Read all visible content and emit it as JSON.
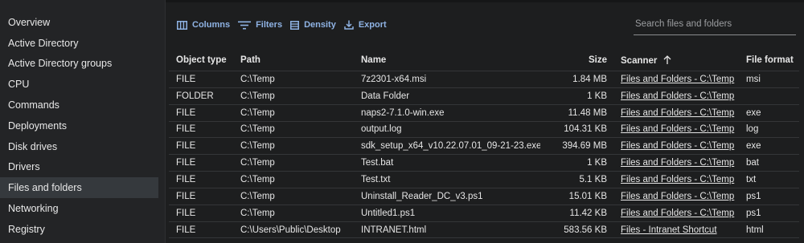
{
  "sidebar": {
    "items": [
      {
        "label": "Overview"
      },
      {
        "label": "Active Directory"
      },
      {
        "label": "Active Directory groups"
      },
      {
        "label": "CPU"
      },
      {
        "label": "Commands"
      },
      {
        "label": "Deployments"
      },
      {
        "label": "Disk drives"
      },
      {
        "label": "Drivers"
      },
      {
        "label": "Files and folders"
      },
      {
        "label": "Networking"
      },
      {
        "label": "Registry"
      }
    ],
    "active": "Files and folders"
  },
  "toolbar": {
    "columns_label": "Columns",
    "filters_label": "Filters",
    "density_label": "Density",
    "export_label": "Export"
  },
  "search": {
    "placeholder": "Search files and folders",
    "value": ""
  },
  "table": {
    "headers": {
      "type": "Object type",
      "path": "Path",
      "name": "Name",
      "size": "Size",
      "scanner": "Scanner",
      "format": "File format"
    },
    "sort": {
      "column": "Scanner",
      "direction": "ascending",
      "icon": "arrow-up-icon"
    },
    "rows": [
      {
        "type": "FILE",
        "path": "C:\\Temp",
        "name": "7z2301-x64.msi",
        "size": "1.84 MB",
        "scanner": "Files and Folders - C:\\Temp",
        "format": "msi"
      },
      {
        "type": "FOLDER",
        "path": "C:\\Temp",
        "name": "Data Folder",
        "size": "1 KB",
        "scanner": "Files and Folders - C:\\Temp",
        "format": ""
      },
      {
        "type": "FILE",
        "path": "C:\\Temp",
        "name": "naps2-7.1.0-win.exe",
        "size": "11.48 MB",
        "scanner": "Files and Folders - C:\\Temp",
        "format": "exe"
      },
      {
        "type": "FILE",
        "path": "C:\\Temp",
        "name": "output.log",
        "size": "104.31 KB",
        "scanner": "Files and Folders - C:\\Temp",
        "format": "log"
      },
      {
        "type": "FILE",
        "path": "C:\\Temp",
        "name": "sdk_setup_x64_v10.22.07.01_09-21-23.exe",
        "size": "394.69 MB",
        "scanner": "Files and Folders - C:\\Temp",
        "format": "exe"
      },
      {
        "type": "FILE",
        "path": "C:\\Temp",
        "name": "Test.bat",
        "size": "1 KB",
        "scanner": "Files and Folders - C:\\Temp",
        "format": "bat"
      },
      {
        "type": "FILE",
        "path": "C:\\Temp",
        "name": "Test.txt",
        "size": "5.1 KB",
        "scanner": "Files and Folders - C:\\Temp",
        "format": "txt"
      },
      {
        "type": "FILE",
        "path": "C:\\Temp",
        "name": "Uninstall_Reader_DC_v3.ps1",
        "size": "15.01 KB",
        "scanner": "Files and Folders - C:\\Temp",
        "format": "ps1"
      },
      {
        "type": "FILE",
        "path": "C:\\Temp",
        "name": "Untitled1.ps1",
        "size": "11.42 KB",
        "scanner": "Files and Folders - C:\\Temp",
        "format": "ps1"
      },
      {
        "type": "FILE",
        "path": "C:\\Users\\Public\\Desktop",
        "name": "INTRANET.html",
        "size": "583.56 KB",
        "scanner": "Files - Intranet Shortcut",
        "format": "html"
      }
    ]
  },
  "colors": {
    "accent": "#8fb3e4",
    "sidebar_bg": "#232426",
    "main_bg": "#1d1e1f",
    "active_bg": "#35393d"
  }
}
